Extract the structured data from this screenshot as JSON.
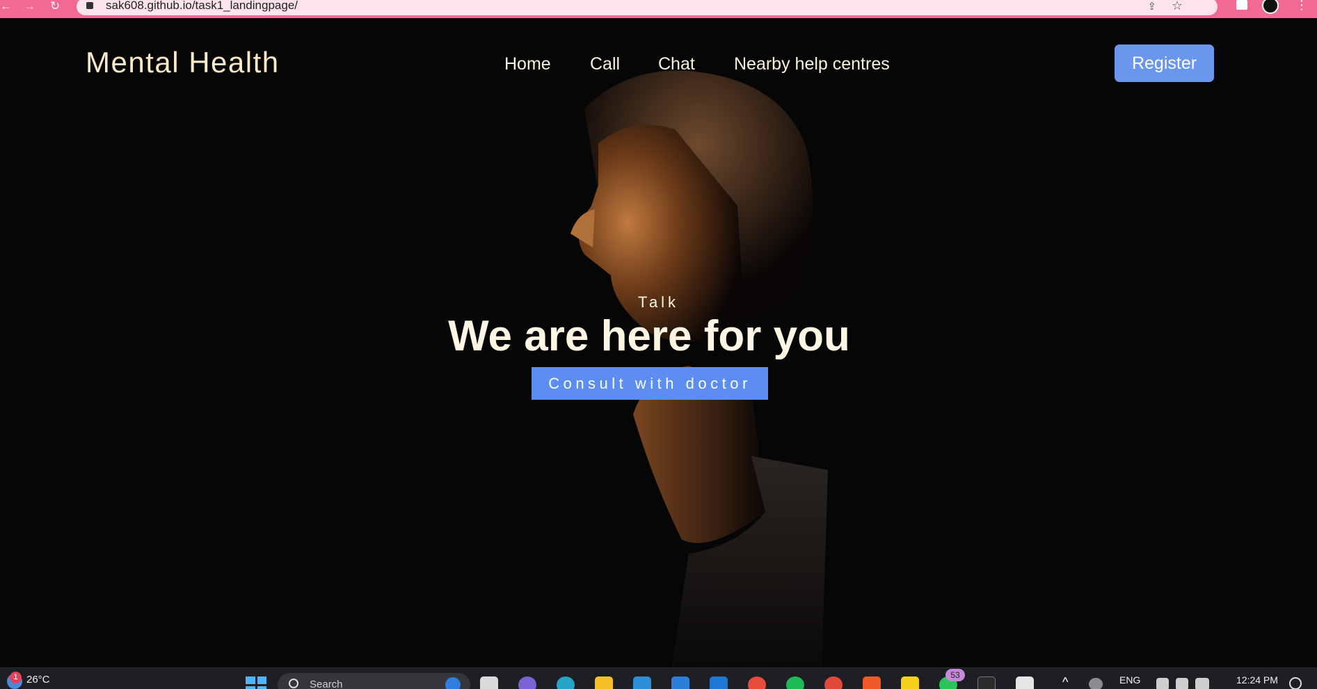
{
  "browser": {
    "url": "sak608.github.io/task1_landingpage/",
    "accent": "#f26a92"
  },
  "site": {
    "brand": "Mental Health",
    "nav": [
      "Home",
      "Call",
      "Chat",
      "Nearby help centres"
    ],
    "register_label": "Register",
    "accent_button": "#6a96ee"
  },
  "hero": {
    "eyebrow": "Talk",
    "headline": "We are here for you",
    "cta_label": "Consult with doctor"
  },
  "taskbar": {
    "weather_badge": "1",
    "temperature": "26°C",
    "search_placeholder": "Search",
    "whatsapp_badge": "53",
    "language": "ENG",
    "time": "12:24 PM",
    "apps": [
      "teams-icon",
      "edge-icon",
      "file-explorer-icon",
      "app-icon",
      "mail-icon",
      "vscode-icon",
      "chrome-icon",
      "spotify-icon",
      "chrome-profile-icon",
      "brave-icon",
      "sticky-notes-icon",
      "whatsapp-icon",
      "terminal-icon",
      "snipping-tool-icon"
    ]
  }
}
